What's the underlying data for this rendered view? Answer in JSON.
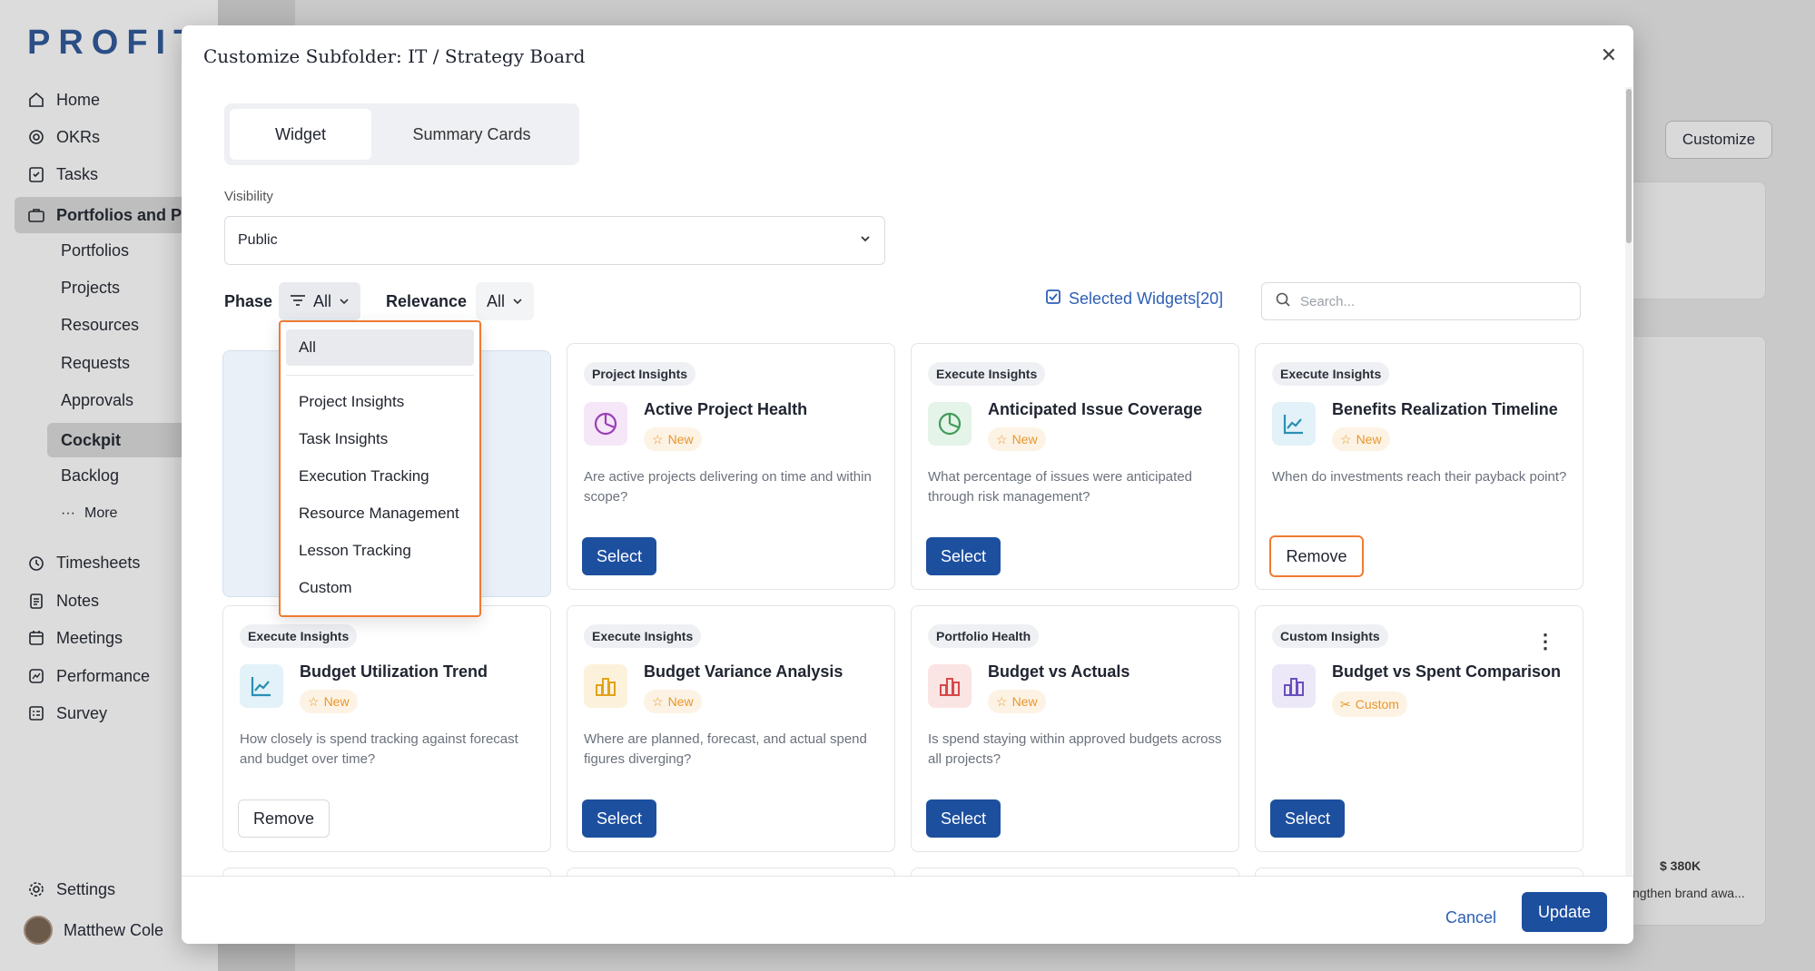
{
  "app": {
    "logo": "PROFIT"
  },
  "sidebar": {
    "items": [
      {
        "label": "Home",
        "icon": "home-icon"
      },
      {
        "label": "OKRs",
        "icon": "target-icon"
      },
      {
        "label": "Tasks",
        "icon": "tasks-icon"
      },
      {
        "label": "Portfolios and Pr",
        "icon": "briefcase-icon"
      }
    ],
    "sub_items": [
      "Portfolios",
      "Projects",
      "Resources",
      "Requests",
      "Approvals",
      "Cockpit",
      "Backlog"
    ],
    "more_label": "More",
    "items2": [
      {
        "label": "Timesheets",
        "icon": "clock-icon"
      },
      {
        "label": "Notes",
        "icon": "notes-icon"
      },
      {
        "label": "Meetings",
        "icon": "calendar-icon"
      },
      {
        "label": "Performance",
        "icon": "performance-icon"
      },
      {
        "label": "Survey",
        "icon": "survey-icon"
      }
    ],
    "settings_label": "Settings",
    "user_name": "Matthew Cole"
  },
  "background": {
    "customize_label": "Customize",
    "value_label": "$ 380K",
    "note_label": "ngthen brand awa..."
  },
  "modal": {
    "title": "Customize Subfolder: IT / Strategy Board",
    "tabs": [
      "Widget",
      "Summary Cards"
    ],
    "visibility_label": "Visibility",
    "visibility_value": "Public",
    "phase_label": "Phase",
    "phase_value": "All",
    "relevance_label": "Relevance",
    "relevance_value": "All",
    "selected_widgets": "Selected Widgets[20]",
    "search_placeholder": "Search...",
    "cancel_label": "Cancel",
    "update_label": "Update",
    "dropdown": [
      "All",
      "Project Insights",
      "Task Insights",
      "Execution Tracking",
      "Resource Management",
      "Lesson Tracking",
      "Custom"
    ],
    "cards": [
      {
        "tag": "Project Insights",
        "title": "Active Project Health",
        "badge": "New",
        "desc": "Are active projects delivering on time and within scope?",
        "button": "Select",
        "icon": "pie-chart-icon",
        "color": "#9b3fb5"
      },
      {
        "tag": "Execute Insights",
        "title": "Anticipated Issue Coverage",
        "badge": "New",
        "desc": "What percentage of issues were anticipated through risk management?",
        "button": "Select",
        "icon": "pie-chart-icon",
        "color": "#3f9b5a"
      },
      {
        "tag": "Execute Insights",
        "title": "Benefits Realization Timeline",
        "badge": "New",
        "desc": "When do investments reach their payback point?",
        "button": "Remove",
        "icon": "line-chart-icon",
        "color": "#2a8fb5"
      },
      {
        "tag": "Execute Insights",
        "title": "Budget Utilization Trend",
        "badge": "New",
        "desc": "How closely is spend tracking against forecast and budget over time?",
        "button": "Remove",
        "icon": "line-chart-icon",
        "color": "#2a8fb5"
      },
      {
        "tag": "Execute Insights",
        "title": "Budget Variance Analysis",
        "badge": "New",
        "desc": "Where are planned, forecast, and actual spend figures diverging?",
        "button": "Select",
        "icon": "bar-chart-icon",
        "color": "#e3a21a"
      },
      {
        "tag": "Portfolio Health",
        "title": "Budget vs Actuals",
        "badge": "New",
        "desc": "Is spend staying within approved budgets across all projects?",
        "button": "Select",
        "icon": "bar-chart-icon",
        "color": "#d84848"
      },
      {
        "tag": "Custom Insights",
        "title": "Budget vs Spent Comparison",
        "badge": "Custom",
        "desc": "",
        "button": "Select",
        "icon": "bar-chart-icon",
        "color": "#6a4fc0"
      }
    ]
  }
}
